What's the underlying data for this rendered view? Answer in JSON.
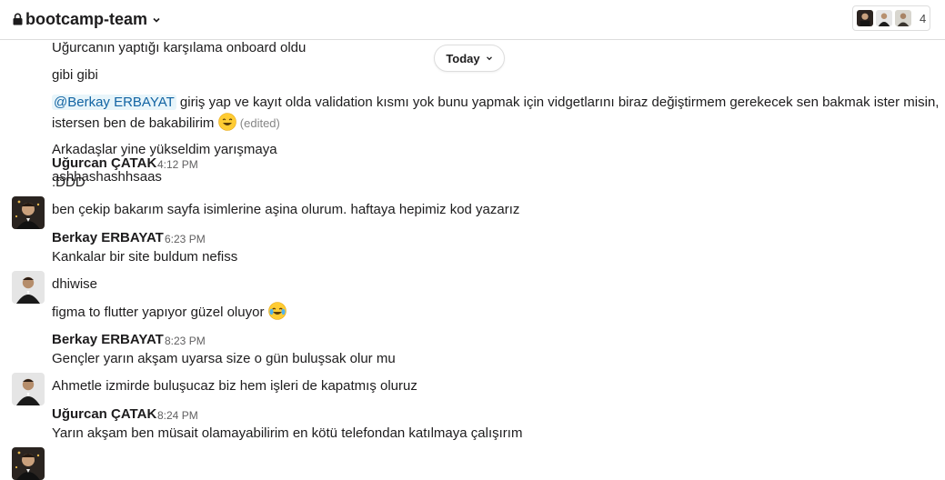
{
  "header": {
    "channel_name": "bootcamp-team",
    "member_count": "4",
    "lock_icon": "lock-icon",
    "chevron_icon": "chevron-down-icon"
  },
  "date_divider": {
    "label": "Today"
  },
  "messages": {
    "cont1": "Uğurcanın yaptığı karşılama onboard oldu",
    "cont2": "gibi gibi",
    "cont3": {
      "mention": "@Berkay ERBAYAT",
      "text1": " giriş yap ve kayıt olda validation kısmı yok bunu yapmak için vidgetlarını biraz değiştirmem gerekecek sen bakmak ister misin,",
      "text2": "istersen ben de bakabilirim",
      "edited": "(edited)",
      "emoji": "smile-emoji"
    },
    "cont4": "Arkadaşlar yine yükseldim yarışmaya",
    "cont5": "ashhashashhsaas",
    "group1": {
      "author": "Uğurcan ÇATAK",
      "time": "4:12 PM",
      "lines": [
        ":DDD",
        "ben çekip bakarım sayfa isimlerine aşina olurum. haftaya hepimiz kod yazarız"
      ]
    },
    "group2": {
      "author": "Berkay ERBAYAT",
      "time": "6:23 PM",
      "lines": [
        "Kankalar bir site buldum nefiss",
        "dhiwise",
        "figma to flutter yapıyor güzel oluyor"
      ],
      "emoji": "joy-emoji"
    },
    "group3": {
      "author": "Berkay ERBAYAT",
      "time": "8:23 PM",
      "lines": [
        "Gençler yarın akşam uyarsa size o gün buluşsak olur mu",
        "Ahmetle izmirde buluşucaz biz hem işleri de kapatmış oluruz"
      ]
    },
    "group4": {
      "author": "Uğurcan ÇATAK",
      "time": "8:24 PM",
      "lines": [
        "Yarın akşam ben müsait olamayabilirim en kötü telefondan katılmaya çalışırım"
      ]
    }
  },
  "colors": {
    "mention_bg": "#e8f5fa",
    "mention_text": "#1264a3",
    "border": "#dddddd",
    "text": "#1d1c1d",
    "muted": "#616061"
  }
}
